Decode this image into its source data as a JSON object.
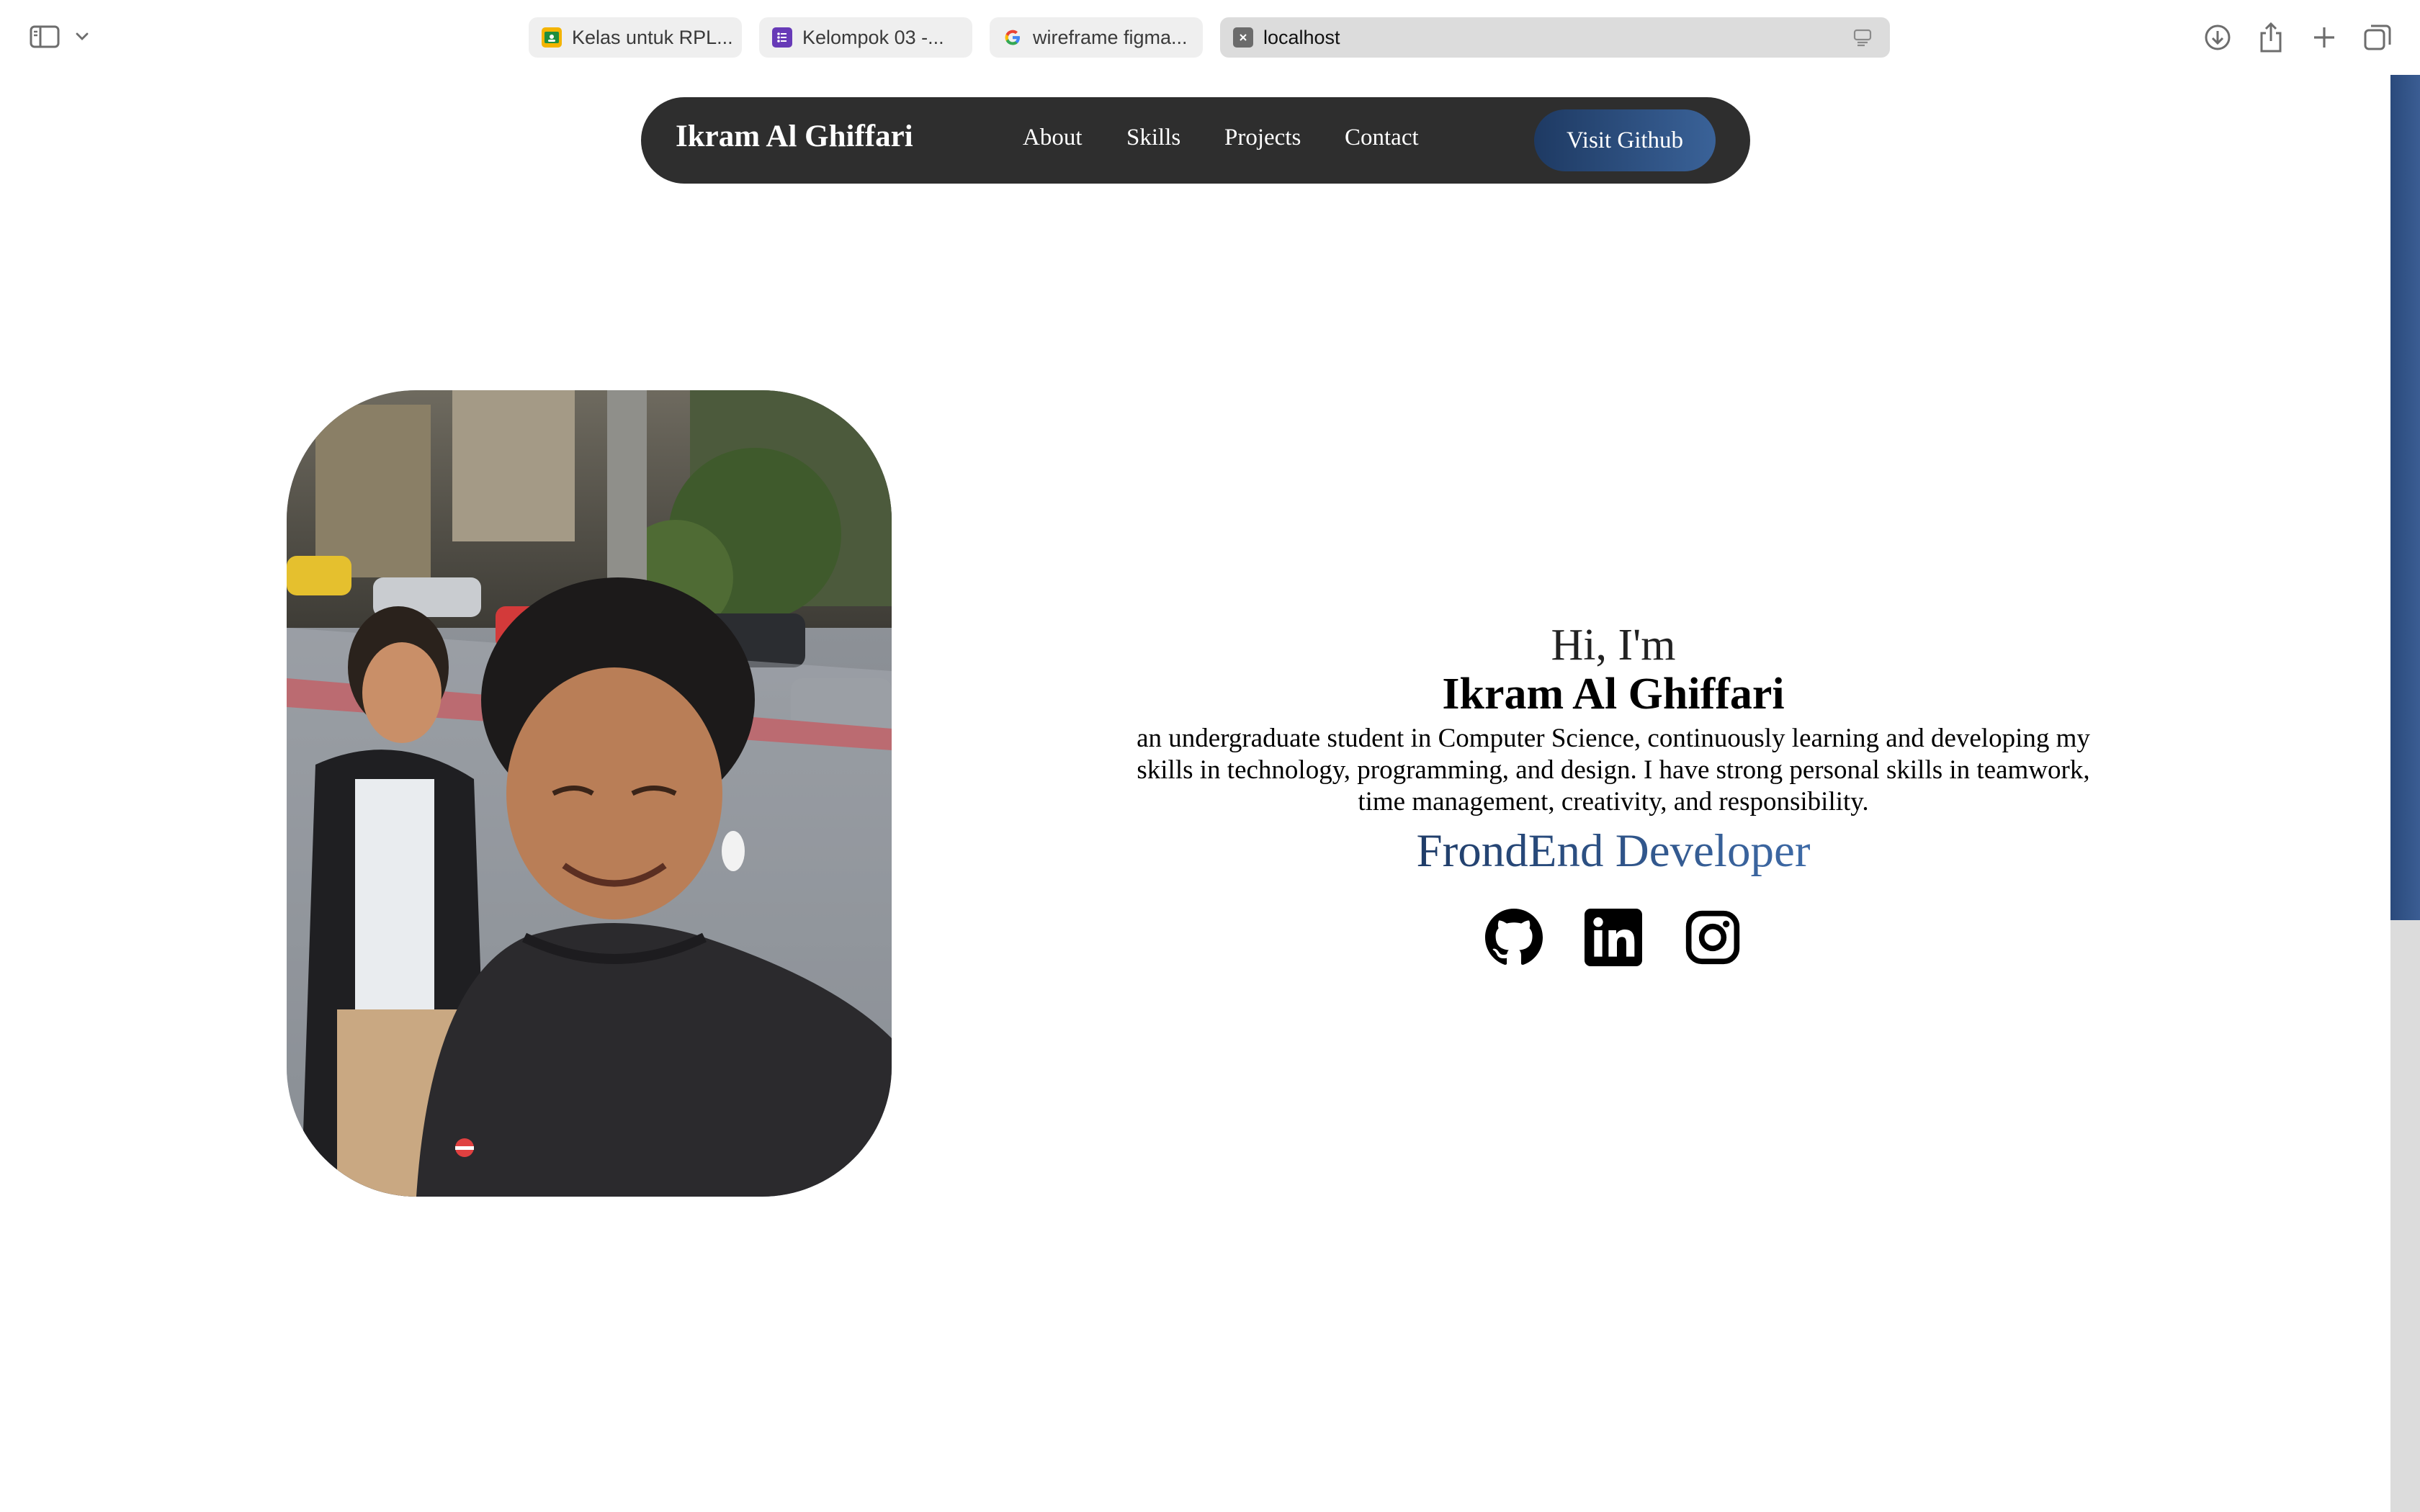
{
  "browser": {
    "tabs": [
      {
        "label": "Kelas untuk RPL...",
        "icon": "classroom-icon"
      },
      {
        "label": "Kelompok 03 -...",
        "icon": "forms-icon"
      },
      {
        "label": "wireframe figma...",
        "icon": "google-icon"
      }
    ],
    "address": "localhost",
    "icons": [
      "sidebar-icon",
      "chevron-down-icon",
      "download-icon",
      "share-icon",
      "plus-icon",
      "tabs-overview-icon"
    ]
  },
  "nav": {
    "brand": "Ikram Al Ghiffari",
    "links": [
      "About",
      "Skills",
      "Projects",
      "Contact"
    ],
    "cta": "Visit Github",
    "cta_color": "#2d5185",
    "background": "#2e2e2e"
  },
  "hero": {
    "greeting": "Hi, I'm",
    "name": "Ikram Al Ghiffari",
    "bio": "an undergraduate student in Computer Science, continuously learning and developing my skills in technology, programming, and design. I have strong personal skills in teamwork, time management, creativity, and responsibility.",
    "role": "FrondEnd Developer",
    "socials": [
      "github-icon",
      "linkedin-icon",
      "instagram-icon"
    ]
  }
}
